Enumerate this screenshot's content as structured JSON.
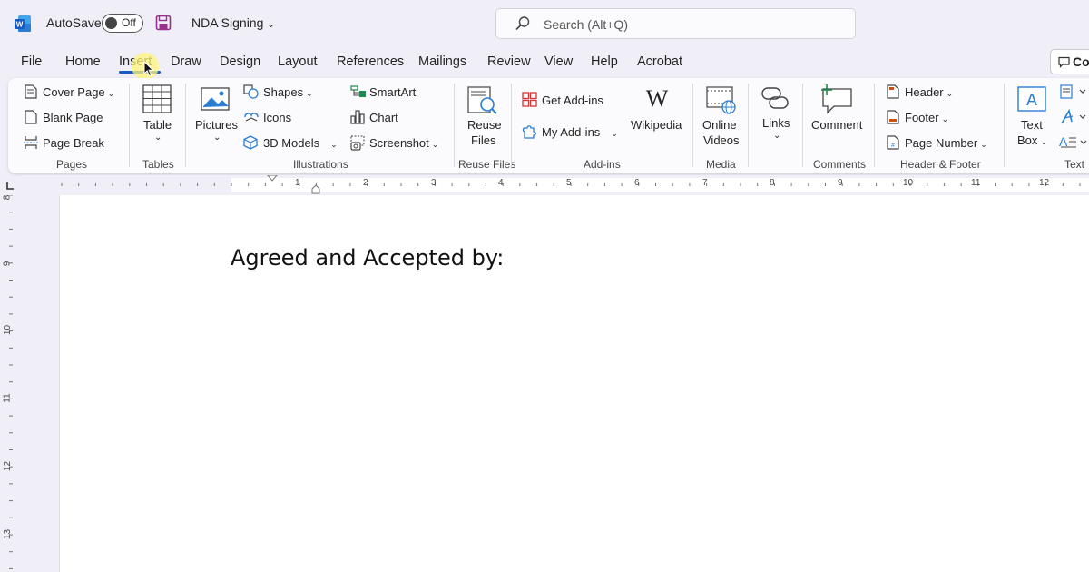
{
  "titlebar": {
    "autosave_label": "AutoSave",
    "autosave_state": "Off",
    "document_title": "NDA Signing",
    "search_placeholder": "Search (Alt+Q)"
  },
  "menu": {
    "tabs": [
      "File",
      "Home",
      "Insert",
      "Draw",
      "Design",
      "Layout",
      "References",
      "Mailings",
      "Review",
      "View",
      "Help",
      "Acrobat"
    ],
    "active_tab": "Insert",
    "comments_label": "Co"
  },
  "ribbon": {
    "pages": {
      "cover_page": "Cover Page",
      "blank_page": "Blank Page",
      "page_break": "Page Break",
      "label": "Pages"
    },
    "tables": {
      "table": "Table",
      "label": "Tables"
    },
    "illustrations": {
      "pictures": "Pictures",
      "shapes": "Shapes",
      "icons": "Icons",
      "models_3d": "3D Models",
      "smartart": "SmartArt",
      "chart": "Chart",
      "screenshot": "Screenshot",
      "label": "Illustrations"
    },
    "reuse_files": {
      "line1": "Reuse",
      "line2": "Files",
      "label": "Reuse Files"
    },
    "addins": {
      "get_addins": "Get Add-ins",
      "my_addins": "My Add-ins",
      "wikipedia": "Wikipedia",
      "label": "Add-ins"
    },
    "media": {
      "line1": "Online",
      "line2": "Videos",
      "label": "Media"
    },
    "links": {
      "links": "Links"
    },
    "comments": {
      "comment": "Comment",
      "label": "Comments"
    },
    "header_footer": {
      "header": "Header",
      "footer": "Footer",
      "page_number": "Page Number",
      "label": "Header & Footer"
    },
    "text": {
      "line1": "Text",
      "line2": "Box",
      "label": "Text"
    }
  },
  "ruler": {
    "horizontal": [
      "1",
      "2",
      "3",
      "4",
      "5",
      "6",
      "7",
      "8",
      "9",
      "10",
      "11",
      "12"
    ],
    "vertical": [
      "8",
      "9",
      "10",
      "11",
      "12",
      "13"
    ]
  },
  "document": {
    "body_text": "Agreed and Accepted by:"
  },
  "colors": {
    "accent": "#185abd",
    "word_blue": "#185abd",
    "background": "#f0eef6",
    "save_icon": "#9b2e8f"
  }
}
